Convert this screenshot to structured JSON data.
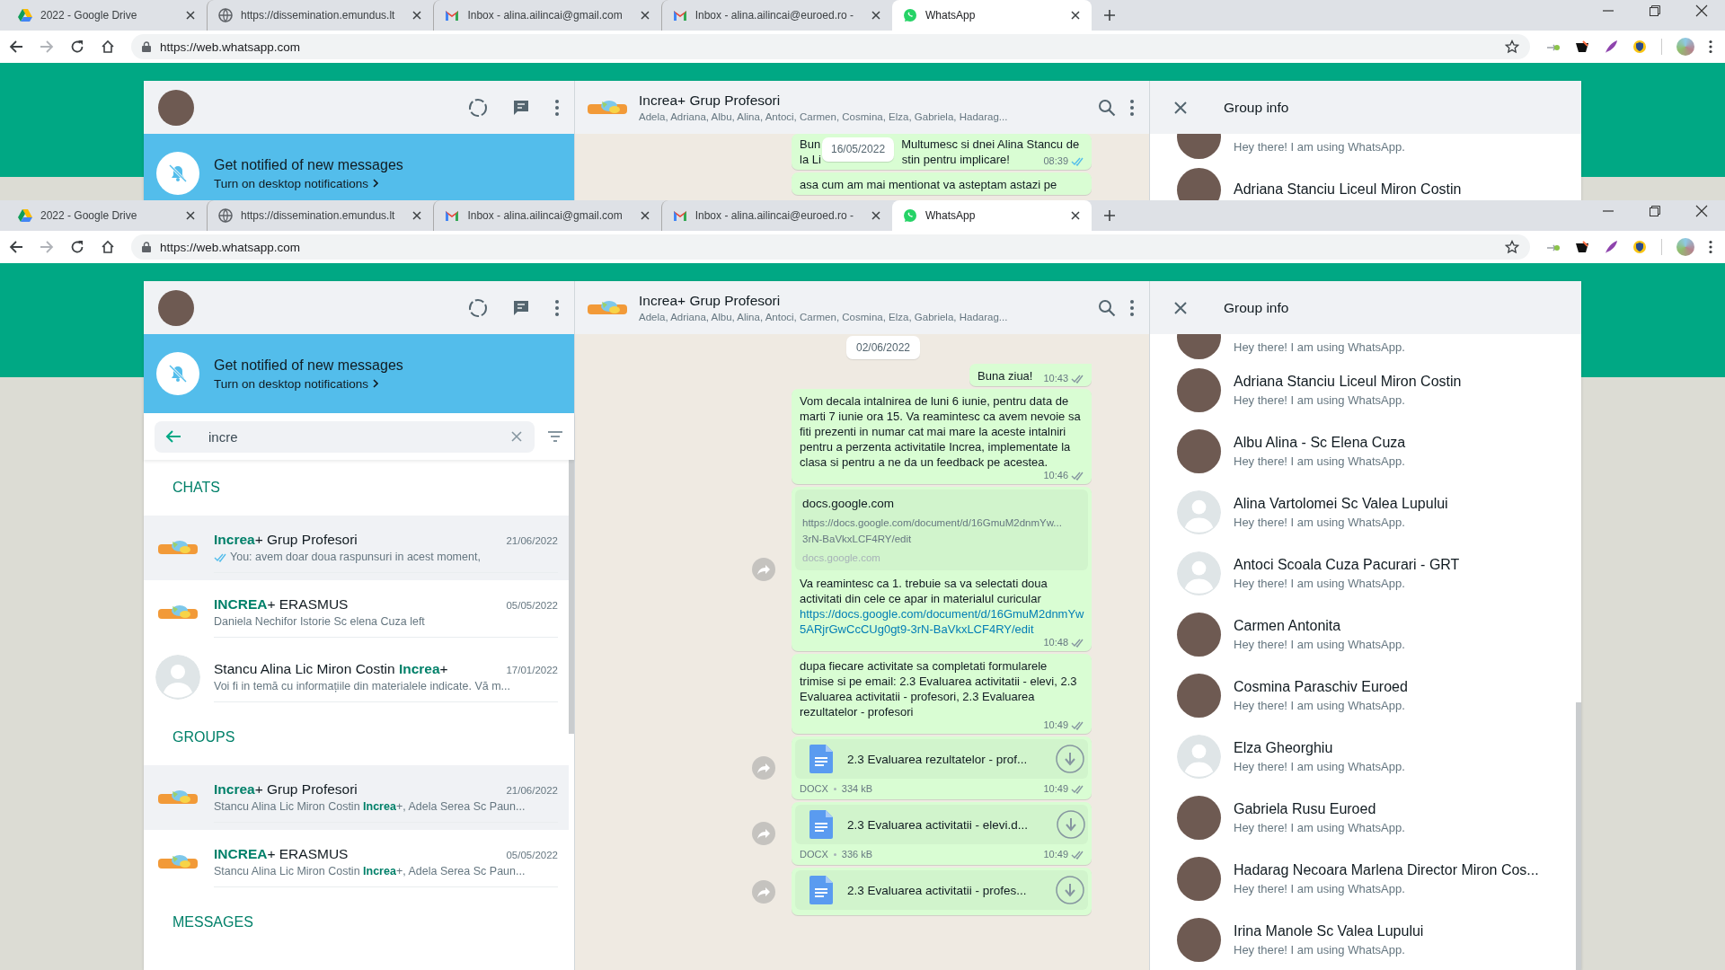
{
  "screens": [
    {
      "browser": {
        "tabs": [
          {
            "kind": "drive",
            "label": "2022 - Google Drive",
            "selected": false
          },
          {
            "kind": "globe",
            "label": "https://dissemination.emundus.lt",
            "selected": false
          },
          {
            "kind": "gmail",
            "label": "Inbox - alina.ailincai@gmail.com",
            "selected": false
          },
          {
            "kind": "gmail",
            "label": "Inbox - alina.ailincai@euroed.ro -",
            "selected": false
          },
          {
            "kind": "whatsapp",
            "label": "WhatsApp",
            "selected": true
          }
        ],
        "forward_enabled": false,
        "url": "https://web.whatsapp.com"
      },
      "sidebar": {
        "banner": {
          "title": "Get notified of new messages",
          "subtitle": "Turn on desktop notifications"
        }
      },
      "chat": {
        "title": "Increa+ Grup Profesori",
        "subtitle": "Adela, Adriana, Albu, Alina, Antoci, Carmen, Cosmina, Elza, Gabriela, Hadarag...",
        "messages": [
          {
            "kind": "covered",
            "badge": "16/05/2022",
            "lines": [
              [
                "Bun",
                "Multumesc si dnei Alina Stancu de"
              ],
              [
                "la Li",
                "stin pentru implicare!"
              ]
            ],
            "time": "08:39",
            "read": true,
            "tail": false,
            "share": false
          },
          {
            "kind": "text",
            "text": "asa cum am mai mentionat va asteptam astazi pe",
            "tail": false,
            "share": false
          }
        ]
      },
      "group_info": {
        "title": "Group info",
        "members": [
          {
            "kind": "photo",
            "status": "Hey there! I am using WhatsApp."
          },
          {
            "kind": "photo",
            "name": "Adriana Stanciu Liceul Miron Costin"
          }
        ]
      }
    },
    {
      "browser": {
        "tabs": [
          {
            "kind": "drive",
            "label": "2022 - Google Drive",
            "selected": false
          },
          {
            "kind": "globe",
            "label": "https://dissemination.emundus.lt",
            "selected": false
          },
          {
            "kind": "gmail",
            "label": "Inbox - alina.ailincai@gmail.com",
            "selected": false
          },
          {
            "kind": "gmail",
            "label": "Inbox - alina.ailincai@euroed.ro -",
            "selected": false
          },
          {
            "kind": "whatsapp",
            "label": "WhatsApp",
            "selected": true
          }
        ],
        "forward_enabled": false,
        "url": "https://web.whatsapp.com"
      },
      "sidebar": {
        "banner": {
          "title": "Get notified of new messages",
          "subtitle": "Turn on desktop notifications"
        },
        "search": {
          "value": "incre"
        },
        "sections": [
          {
            "heading": "CHATS",
            "items": [
              {
                "kind": "logo",
                "title": "**Increa**+ Grup Profesori",
                "date": "21/06/2022",
                "preview": "You: avem doar doua raspunsuri in acest moment,",
                "ticks": true,
                "selected": true
              },
              {
                "kind": "logo",
                "title": "**INCREA**+ ERASMUS",
                "date": "05/05/2022",
                "preview": "Daniela Nechifor Istorie Sc elena Cuza left",
                "ticks": false,
                "selected": false
              },
              {
                "kind": "default",
                "title": "Stancu Alina Lic Miron Costin **Increa**+",
                "date": "17/01/2022",
                "preview": "Voi fi in temă cu informațiile din materialele indicate. Vă m...",
                "ticks": false,
                "selected": false
              }
            ]
          },
          {
            "heading": "GROUPS",
            "items": [
              {
                "kind": "logo",
                "title": "**Increa**+ Grup Profesori",
                "date": "21/06/2022",
                "preview": "Stancu Alina Lic Miron Costin **Increa**+, Adela Serea Sc Paun...",
                "ticks": false,
                "selected": true
              },
              {
                "kind": "logo",
                "title": "**INCREA**+ ERASMUS",
                "date": "05/05/2022",
                "preview": "Stancu Alina Lic Miron Costin **Increa**+, Adela Serea Sc Paun...",
                "ticks": false,
                "selected": false
              }
            ]
          },
          {
            "heading": "MESSAGES"
          }
        ]
      },
      "chat": {
        "title": "Increa+ Grup Profesori",
        "subtitle": "Adela, Adriana, Albu, Alina, Antoci, Carmen, Cosmina, Elza, Gabriela, Hadarag...",
        "date": "02/06/2022",
        "messages": [
          {
            "kind": "text",
            "text": "Buna ziua!",
            "time": "10:43",
            "read": false,
            "tail": true,
            "share": false
          },
          {
            "kind": "text",
            "text": "Vom decala intalnirea de luni 6 iunie, pentru data de marti 7 iunie ora 15. Va reamintesc ca avem nevoie sa fiti prezenti in numar cat mai mare la aceste intalniri pentru a perzenta activitatile Increa, implementate la clasa si pentru a ne da un feedback pe acestea.",
            "time": "10:46",
            "read": false,
            "tail": false,
            "share": false
          },
          {
            "kind": "link",
            "preview": {
              "title": "docs.google.com",
              "description": "https://docs.google.com/document/d/16GmuM2dnmYw... 3rN-BaVkxLCF4RY/edit",
              "site": "docs.google.com"
            },
            "text": "Va reamintesc ca 1. trebuie sa va selectati doua activitati din cele ce apar in materialul curicular",
            "link": "https://docs.google.com/document/d/16GmuM2dnmYw5ARjrGwCcCUg0gt9-3rN-BaVkxLCF4RY/edit",
            "time": "10:48",
            "read": false,
            "tail": false,
            "share": true
          },
          {
            "kind": "text",
            "text": "dupa fiecare activitate sa completati formularele trimise si pe email: 2.3 Evaluarea activitatii - elevi, 2.3 Evaluarea activitatii - profesori, 2.3 Evaluarea rezultatelor - profesori",
            "time": "10:49",
            "read": false,
            "tail": false,
            "share": false
          },
          {
            "kind": "document",
            "name": "2.3 Evaluarea rezultatelor - prof...",
            "type": "DOCX",
            "size": "334 kB",
            "time": "10:49",
            "read": false,
            "tail": false,
            "share": true
          },
          {
            "kind": "document",
            "name": "2.3 Evaluarea activitatii - elevi.d...",
            "type": "DOCX",
            "size": "336 kB",
            "time": "10:49",
            "read": false,
            "tail": false,
            "share": true
          },
          {
            "kind": "document",
            "name": "2.3 Evaluarea activitatii - profes...",
            "tail": false,
            "share": true
          }
        ]
      },
      "group_info": {
        "title": "Group info",
        "members": [
          {
            "kind": "photo",
            "status": "Hey there! I am using WhatsApp."
          },
          {
            "kind": "photo",
            "name": "Adriana Stanciu Liceul Miron Costin",
            "status": "Hey there! I am using WhatsApp."
          },
          {
            "kind": "photo",
            "name": "Albu Alina - Sc Elena Cuza",
            "status": "Hey there! I am using WhatsApp."
          },
          {
            "kind": "default",
            "name": "Alina Vartolomei Sc Valea Lupului",
            "status": "Hey there! I am using WhatsApp."
          },
          {
            "kind": "default",
            "name": "Antoci Scoala Cuza Pacurari - GRT",
            "status": "Hey there! I am using WhatsApp."
          },
          {
            "kind": "photo",
            "name": "Carmen Antonita",
            "status": "Hey there! I am using WhatsApp."
          },
          {
            "kind": "photo",
            "name": "Cosmina Paraschiv Euroed",
            "status": "Hey there! I am using WhatsApp."
          },
          {
            "kind": "default",
            "name": "Elza Gheorghiu",
            "status": "Hey there! I am using WhatsApp."
          },
          {
            "kind": "photo",
            "name": "Gabriela Rusu Euroed",
            "status": "Hey there! I am using WhatsApp."
          },
          {
            "kind": "photo",
            "name": "Hadarag Necoara Marlena Director Miron Cos...",
            "status": "Hey there! I am using WhatsApp."
          },
          {
            "kind": "photo",
            "name": "Irina Manole Sc Valea Lupului",
            "status": "Hey there! I am using WhatsApp."
          }
        ]
      }
    }
  ]
}
